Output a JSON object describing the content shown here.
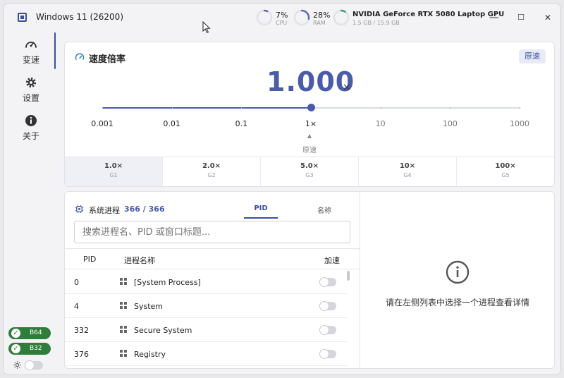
{
  "app": {
    "title": "Windows 11 (26200)"
  },
  "metrics": {
    "cpu": {
      "value": "7%",
      "label": "CPU",
      "fraction": 0.07
    },
    "ram": {
      "value": "28%",
      "label": "RAM",
      "fraction": 0.28
    },
    "gpu": {
      "name": "NVIDIA GeForce RTX 5080 Laptop GPU",
      "memory": "1.5 GB / 15.9 GB",
      "fraction": 0.094
    }
  },
  "window_controls": {
    "minimize": "—",
    "maximize": "☐",
    "close": "✕"
  },
  "sidebar": {
    "items": [
      {
        "label": "变速",
        "icon": "speedometer-icon",
        "active": true
      },
      {
        "label": "设置",
        "icon": "gear-icon",
        "active": false
      },
      {
        "label": "关于",
        "icon": "info-icon",
        "active": false
      }
    ],
    "badges": [
      {
        "label": "B64"
      },
      {
        "label": "B32"
      }
    ],
    "theme_toggle_icon": "sun-icon"
  },
  "speed": {
    "title": "速度倍率",
    "reset_label": "原速",
    "value": "1.000",
    "unit": "×",
    "scale_labels": [
      "0.001",
      "0.01",
      "0.1",
      "1×",
      "10",
      "100",
      "1000"
    ],
    "current_multiplier": 1,
    "marker_label": "原速",
    "presets": [
      {
        "value": "1.0×",
        "label": "G1",
        "active": true
      },
      {
        "value": "2.0×",
        "label": "G2",
        "active": false
      },
      {
        "value": "5.0×",
        "label": "G3",
        "active": false
      },
      {
        "value": "10×",
        "label": "G4",
        "active": false
      },
      {
        "value": "100×",
        "label": "G5",
        "active": false
      }
    ]
  },
  "processes": {
    "title": "系统进程",
    "count": "366 / 366",
    "tabs": [
      {
        "label": "PID",
        "active": true
      },
      {
        "label": "名称",
        "active": false
      }
    ],
    "search_placeholder": "搜索进程名、PID 或窗口标题...",
    "columns": {
      "pid": "PID",
      "name": "进程名称",
      "speed": "加速"
    },
    "rows": [
      {
        "pid": "0",
        "name": "[System Process]",
        "accelerated": false
      },
      {
        "pid": "4",
        "name": "System",
        "accelerated": false
      },
      {
        "pid": "332",
        "name": "Secure System",
        "accelerated": false
      },
      {
        "pid": "376",
        "name": "Registry",
        "accelerated": false
      }
    ],
    "empty_detail": "请在左侧列表中选择一个进程查看详情"
  },
  "colors": {
    "accent": "#4a5ba8",
    "badge_green": "#2f7d3a",
    "cpu_ring": "#5b6bb0",
    "ram_ring": "#5b6bb0",
    "gpu_ring": "#3aa07a"
  }
}
